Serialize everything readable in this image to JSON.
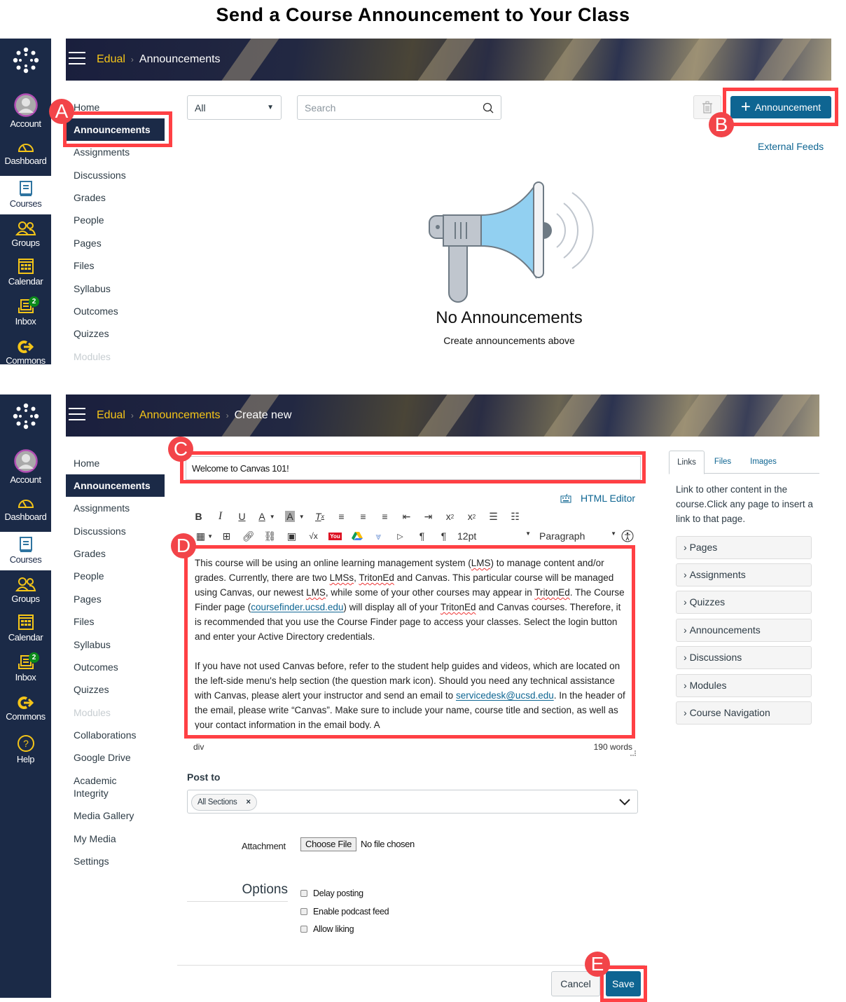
{
  "title": "Send a Course Announcement to Your Class",
  "global_nav": [
    {
      "label": "Account",
      "icon": "avatar-icon"
    },
    {
      "label": "Dashboard",
      "icon": "dashboard-gauge-icon"
    },
    {
      "label": "Courses",
      "icon": "book-icon"
    },
    {
      "label": "Groups",
      "icon": "groups-icon"
    },
    {
      "label": "Calendar",
      "icon": "calendar-icon"
    },
    {
      "label": "Inbox",
      "icon": "inbox-icon",
      "badge": "2"
    },
    {
      "label": "Commons",
      "icon": "commons-icon"
    },
    {
      "label": "Help",
      "icon": "help-icon"
    }
  ],
  "panel1": {
    "breadcrumb": {
      "course": "Edual",
      "current": "Announcements"
    },
    "course_nav": [
      "Home",
      "Announcements",
      "Assignments",
      "Discussions",
      "Grades",
      "People",
      "Pages",
      "Files",
      "Syllabus",
      "Outcomes",
      "Quizzes",
      "Modules"
    ],
    "filter_select": "All",
    "search_placeholder": "Search",
    "add_button": "Announcement",
    "external_feeds": "External Feeds",
    "empty_title": "No Announcements",
    "empty_subtitle": "Create announcements above",
    "markers": {
      "a": "A",
      "b": "B"
    }
  },
  "panel2": {
    "breadcrumb": {
      "course": "Edual",
      "section": "Announcements",
      "current": "Create new"
    },
    "course_nav": [
      "Home",
      "Announcements",
      "Assignments",
      "Discussions",
      "Grades",
      "People",
      "Pages",
      "Files",
      "Syllabus",
      "Outcomes",
      "Quizzes",
      "Modules",
      "Collaborations",
      "Google Drive",
      "Academic Integrity",
      "Media Gallery",
      "My Media",
      "Settings"
    ],
    "title_value": "Welcome to Canvas 101!",
    "html_editor": "HTML Editor",
    "font_size": "12pt",
    "block_format": "Paragraph",
    "body": {
      "p1": {
        "s1": "This course will be using an online learning management system (",
        "lms": "LMS",
        "s2": ") to manage content and/or grades. Currently, there are two ",
        "lmss": "LMSs",
        "s3": ", ",
        "tritoned1": "TritonEd",
        "s4": " and Canvas. This particular course will be managed using Canvas, our newest ",
        "lms2": "LMS",
        "s5": ", while some of your other courses may appear in ",
        "tritoned2": "TritonEd",
        "s6": ". The Course Finder page (",
        "link": "coursefinder.ucsd.edu",
        "s7": ") will display all of your ",
        "tritoned3": "TritonEd",
        "s8": " and Canvas courses. Therefore, it is recommended that you use the Course Finder page to access your classes. Select the login button and enter your Active Directory credentials."
      },
      "p2": {
        "s1": "If you have not used Canvas before, refer to the student help guides and videos, which are located on the left-side menu's help section (the question mark icon). Should you need any technical assistance with Canvas, please alert your instructor and send an email to ",
        "email": "servicedesk@ucsd.edu",
        "s2": ". In the header of the email, please write “Canvas”. Make sure to include your name, course title and section, as well as your contact information in the email body. A"
      }
    },
    "status_path": "div",
    "word_count": "190 words",
    "post_to_label": "Post to",
    "post_to_tag": "All Sections",
    "attachment_label": "Attachment",
    "choose_file": "Choose File",
    "no_file": "No file chosen",
    "options_label": "Options",
    "options": [
      "Delay posting",
      "Enable podcast feed",
      "Allow liking"
    ],
    "cancel": "Cancel",
    "save": "Save",
    "side_tabs": [
      "Links",
      "Files",
      "Images"
    ],
    "side_help": "Link to other content in the course.Click any page to insert a link to that page.",
    "side_sections": [
      "Pages",
      "Assignments",
      "Quizzes",
      "Announcements",
      "Discussions",
      "Modules",
      "Course Navigation"
    ],
    "markers": {
      "c": "C",
      "d": "D",
      "e": "E"
    }
  },
  "colors": {
    "nav_bg": "#1b2a47",
    "accent": "#0e6592",
    "callout": "#ff4044",
    "nav_icon": "#f5c518",
    "badge": "#0b8a1a"
  }
}
